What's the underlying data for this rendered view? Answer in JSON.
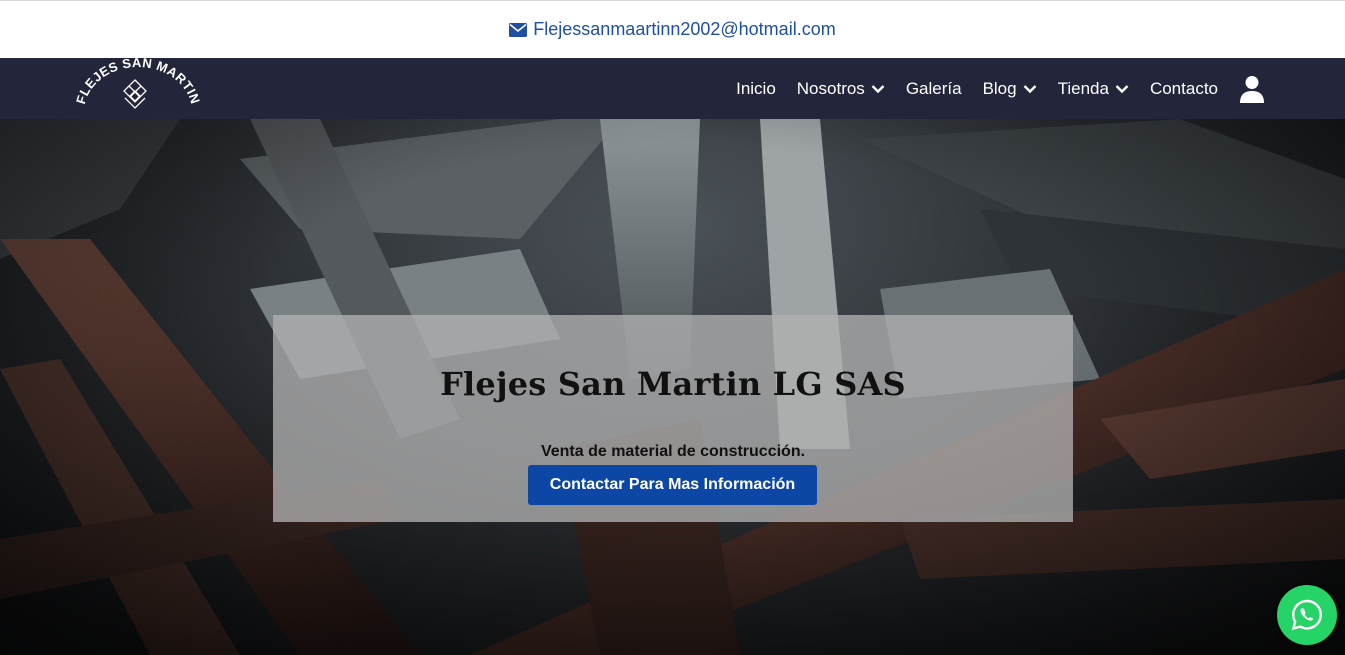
{
  "topbar": {
    "email": "Flejessanmaartinn2002@hotmail.com",
    "email_icon": "envelope-icon"
  },
  "brand": {
    "logo_text": "FLEJES SAN MARTIN"
  },
  "nav": {
    "items": [
      {
        "label": "Inicio",
        "dropdown": false
      },
      {
        "label": "Nosotros",
        "dropdown": true
      },
      {
        "label": "Galería",
        "dropdown": false
      },
      {
        "label": "Blog",
        "dropdown": true
      },
      {
        "label": "Tienda",
        "dropdown": true
      },
      {
        "label": "Contacto",
        "dropdown": false
      }
    ],
    "account_icon": "user-icon"
  },
  "hero": {
    "title": "Flejes San Martin LG SAS",
    "subtitle": "Venta de material de construcción.",
    "cta_label": "Contactar Para Mas Información"
  },
  "floating": {
    "whatsapp_icon": "whatsapp-icon"
  },
  "colors": {
    "nav_bg": "#23253a",
    "accent": "#0d47a6",
    "link": "#1f4fa3",
    "whatsapp": "#25d366"
  }
}
